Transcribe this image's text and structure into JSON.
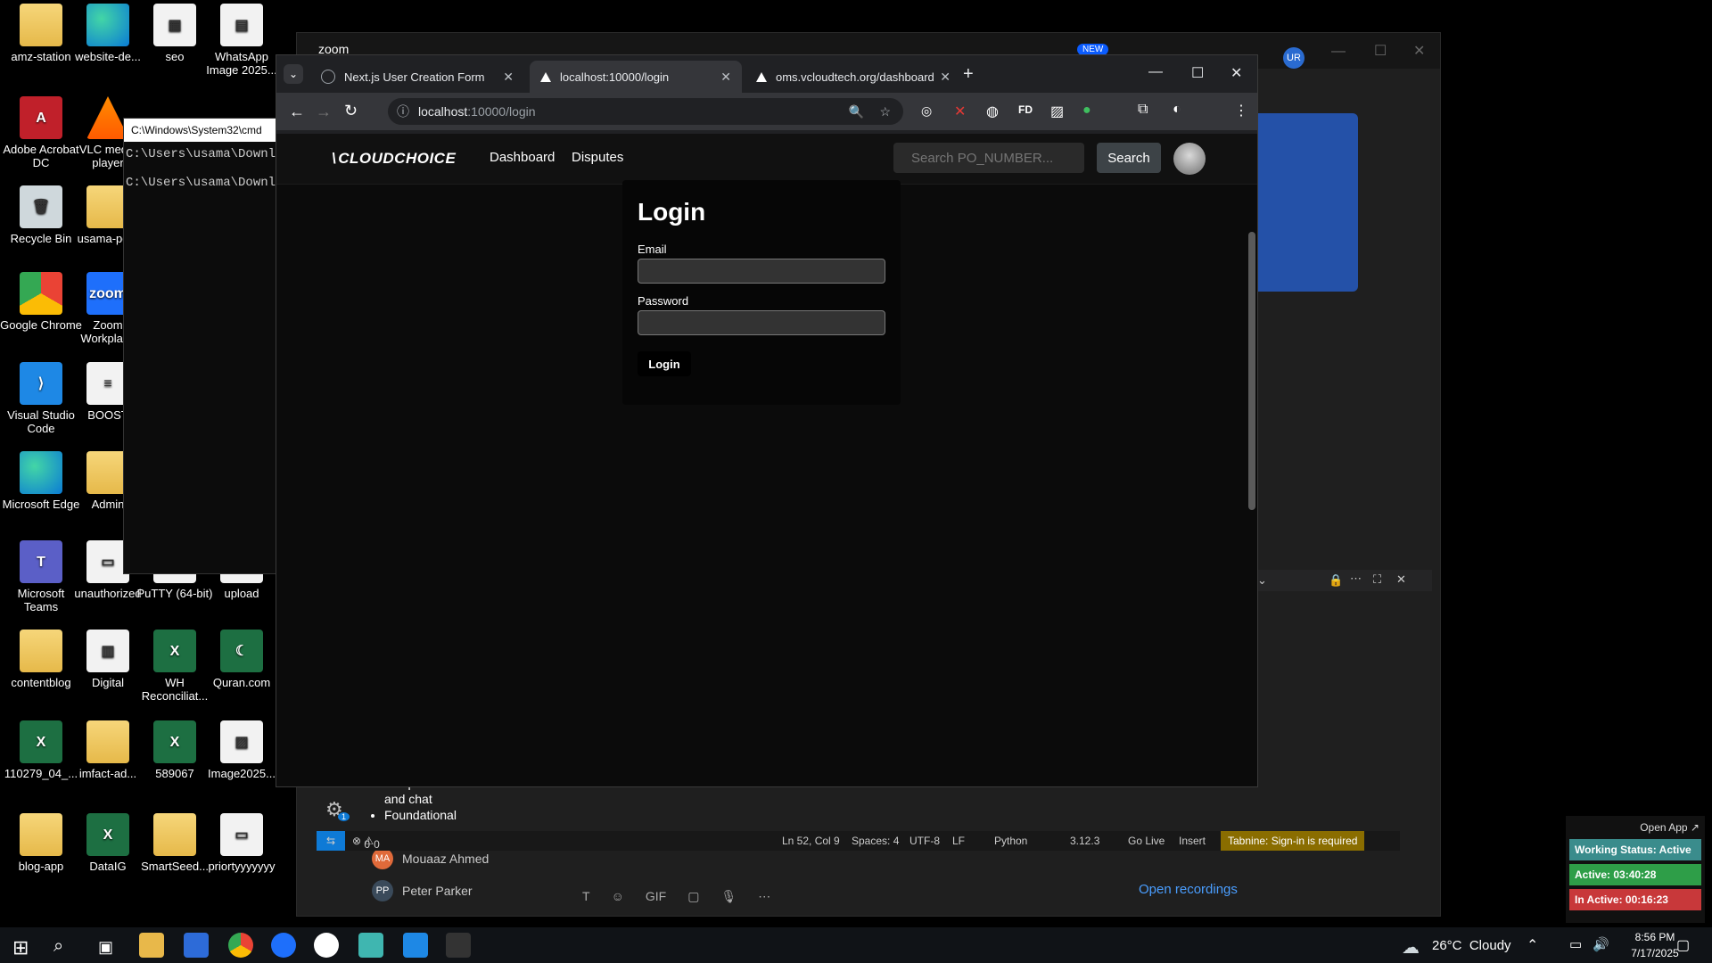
{
  "desktop_icons": [
    {
      "label": "amz-station",
      "kind": "folder",
      "glyph": ""
    },
    {
      "label": "website-de...",
      "kind": "edge",
      "glyph": ""
    },
    {
      "label": "seo",
      "kind": "doc",
      "glyph": "▦"
    },
    {
      "label": "WhatsApp Image 2025...",
      "kind": "doc",
      "glyph": "▤"
    },
    {
      "label": "Adobe Acrobat DC",
      "kind": "pdf",
      "glyph": "A"
    },
    {
      "label": "VLC media player",
      "kind": "vlc",
      "glyph": ""
    },
    {
      "label": "Recycle Bin",
      "kind": "bin",
      "glyph": "🗑"
    },
    {
      "label": "usama-po...",
      "kind": "folder",
      "glyph": ""
    },
    {
      "label": "Google Chrome",
      "kind": "chrome",
      "glyph": ""
    },
    {
      "label": "Zoom Workplace",
      "kind": "zoomi",
      "glyph": "zoom"
    },
    {
      "label": "Visual Studio Code",
      "kind": "vsc",
      "glyph": "⟩"
    },
    {
      "label": "BOOST",
      "kind": "doc",
      "glyph": "≡"
    },
    {
      "label": "Microsoft Edge",
      "kind": "edge",
      "glyph": ""
    },
    {
      "label": "Admin",
      "kind": "folder",
      "glyph": ""
    },
    {
      "label": "Microsoft Teams",
      "kind": "teams",
      "glyph": "T"
    },
    {
      "label": "unauthorized",
      "kind": "doc",
      "glyph": "▭"
    },
    {
      "label": "PuTTY (64-bit)",
      "kind": "doc",
      "glyph": "▣"
    },
    {
      "label": "upload",
      "kind": "doc",
      "glyph": "▯"
    },
    {
      "label": "contentblog",
      "kind": "folder",
      "glyph": ""
    },
    {
      "label": "Digital",
      "kind": "doc",
      "glyph": "▥"
    },
    {
      "label": "WH Reconciliat...",
      "kind": "xls",
      "glyph": "X"
    },
    {
      "label": "Quran.com",
      "kind": "xls",
      "glyph": "☾"
    },
    {
      "label": "110279_04_...",
      "kind": "xls",
      "glyph": "X"
    },
    {
      "label": "imfact-ad...",
      "kind": "folder",
      "glyph": ""
    },
    {
      "label": "589067",
      "kind": "xls",
      "glyph": "X"
    },
    {
      "label": "Image2025...",
      "kind": "doc",
      "glyph": "▨"
    },
    {
      "label": "blog-app",
      "kind": "folder",
      "glyph": ""
    },
    {
      "label": "DataIG",
      "kind": "xls",
      "glyph": "X"
    },
    {
      "label": "SmartSeed...",
      "kind": "folder",
      "glyph": ""
    },
    {
      "label": "priortyyyyyyy",
      "kind": "doc",
      "glyph": "▭"
    }
  ],
  "cmd": {
    "title": "C:\\Windows\\System32\\cmd",
    "line1": "C:\\Users\\usama\\Downloa",
    "line2": "C:\\Users\\usama\\Downloa"
  },
  "zoom_bar": {
    "label": "zoom",
    "new_badge": "NEW",
    "avatar": "UR"
  },
  "browser": {
    "tabs": [
      {
        "title": "Next.js User Creation Form",
        "active": false
      },
      {
        "title": "localhost:10000/login",
        "active": true
      },
      {
        "title": "oms.vcloudtech.org/dashboard",
        "active": false
      }
    ],
    "url_host": "localhost",
    "url_rest": ":10000/login",
    "new_tab": "+"
  },
  "app": {
    "brand": "CLOUDCHOICE",
    "nav": [
      "Dashboard",
      "Disputes"
    ],
    "search_placeholder": "Search PO_NUMBER...",
    "search_button": "Search",
    "login": {
      "title": "Login",
      "email_label": "Email",
      "password_label": "Password",
      "button": "Login"
    }
  },
  "vscode": {
    "list": [
      "completions",
      "and chat",
      "Foundational"
    ],
    "status": {
      "errors": "0",
      "warnings": "0",
      "position": "Ln 52, Col 9",
      "spaces": "Spaces: 4",
      "encoding": "UTF-8",
      "eol": "LF",
      "language": "Python",
      "version": "3.12.3",
      "golive": "Go Live",
      "mode": "Insert",
      "tabnine": "Tabnine: Sign-in is required"
    },
    "badge": "1"
  },
  "teams": {
    "people": [
      {
        "initials": "MA",
        "name": "Mouaaz Ahmed"
      },
      {
        "initials": "PP",
        "name": "Peter Parker"
      }
    ],
    "recordings": "Open recordings",
    "gif": "GIF"
  },
  "tracker": {
    "open_app": "Open App ↗",
    "working": "Working Status: Active",
    "active": "Active: 03:40:28",
    "inactive": "In Active: 00:16:23",
    "colors": {
      "working": "#3a8c8c",
      "active": "#2e9e48",
      "inactive": "#c8383a"
    }
  },
  "taskbar": {
    "weather": "26°C  Cloudy",
    "time": "8:56 PM",
    "date": "7/17/2025"
  }
}
